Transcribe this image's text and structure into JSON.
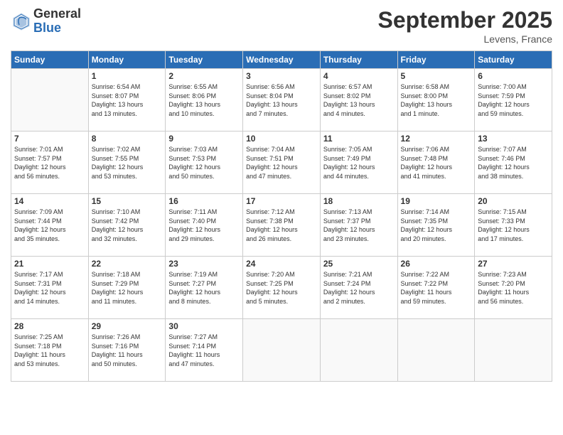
{
  "logo": {
    "general": "General",
    "blue": "Blue"
  },
  "title": "September 2025",
  "location": "Levens, France",
  "days_header": [
    "Sunday",
    "Monday",
    "Tuesday",
    "Wednesday",
    "Thursday",
    "Friday",
    "Saturday"
  ],
  "weeks": [
    [
      {
        "day": "",
        "info": ""
      },
      {
        "day": "1",
        "info": "Sunrise: 6:54 AM\nSunset: 8:07 PM\nDaylight: 13 hours\nand 13 minutes."
      },
      {
        "day": "2",
        "info": "Sunrise: 6:55 AM\nSunset: 8:06 PM\nDaylight: 13 hours\nand 10 minutes."
      },
      {
        "day": "3",
        "info": "Sunrise: 6:56 AM\nSunset: 8:04 PM\nDaylight: 13 hours\nand 7 minutes."
      },
      {
        "day": "4",
        "info": "Sunrise: 6:57 AM\nSunset: 8:02 PM\nDaylight: 13 hours\nand 4 minutes."
      },
      {
        "day": "5",
        "info": "Sunrise: 6:58 AM\nSunset: 8:00 PM\nDaylight: 13 hours\nand 1 minute."
      },
      {
        "day": "6",
        "info": "Sunrise: 7:00 AM\nSunset: 7:59 PM\nDaylight: 12 hours\nand 59 minutes."
      }
    ],
    [
      {
        "day": "7",
        "info": "Sunrise: 7:01 AM\nSunset: 7:57 PM\nDaylight: 12 hours\nand 56 minutes."
      },
      {
        "day": "8",
        "info": "Sunrise: 7:02 AM\nSunset: 7:55 PM\nDaylight: 12 hours\nand 53 minutes."
      },
      {
        "day": "9",
        "info": "Sunrise: 7:03 AM\nSunset: 7:53 PM\nDaylight: 12 hours\nand 50 minutes."
      },
      {
        "day": "10",
        "info": "Sunrise: 7:04 AM\nSunset: 7:51 PM\nDaylight: 12 hours\nand 47 minutes."
      },
      {
        "day": "11",
        "info": "Sunrise: 7:05 AM\nSunset: 7:49 PM\nDaylight: 12 hours\nand 44 minutes."
      },
      {
        "day": "12",
        "info": "Sunrise: 7:06 AM\nSunset: 7:48 PM\nDaylight: 12 hours\nand 41 minutes."
      },
      {
        "day": "13",
        "info": "Sunrise: 7:07 AM\nSunset: 7:46 PM\nDaylight: 12 hours\nand 38 minutes."
      }
    ],
    [
      {
        "day": "14",
        "info": "Sunrise: 7:09 AM\nSunset: 7:44 PM\nDaylight: 12 hours\nand 35 minutes."
      },
      {
        "day": "15",
        "info": "Sunrise: 7:10 AM\nSunset: 7:42 PM\nDaylight: 12 hours\nand 32 minutes."
      },
      {
        "day": "16",
        "info": "Sunrise: 7:11 AM\nSunset: 7:40 PM\nDaylight: 12 hours\nand 29 minutes."
      },
      {
        "day": "17",
        "info": "Sunrise: 7:12 AM\nSunset: 7:38 PM\nDaylight: 12 hours\nand 26 minutes."
      },
      {
        "day": "18",
        "info": "Sunrise: 7:13 AM\nSunset: 7:37 PM\nDaylight: 12 hours\nand 23 minutes."
      },
      {
        "day": "19",
        "info": "Sunrise: 7:14 AM\nSunset: 7:35 PM\nDaylight: 12 hours\nand 20 minutes."
      },
      {
        "day": "20",
        "info": "Sunrise: 7:15 AM\nSunset: 7:33 PM\nDaylight: 12 hours\nand 17 minutes."
      }
    ],
    [
      {
        "day": "21",
        "info": "Sunrise: 7:17 AM\nSunset: 7:31 PM\nDaylight: 12 hours\nand 14 minutes."
      },
      {
        "day": "22",
        "info": "Sunrise: 7:18 AM\nSunset: 7:29 PM\nDaylight: 12 hours\nand 11 minutes."
      },
      {
        "day": "23",
        "info": "Sunrise: 7:19 AM\nSunset: 7:27 PM\nDaylight: 12 hours\nand 8 minutes."
      },
      {
        "day": "24",
        "info": "Sunrise: 7:20 AM\nSunset: 7:25 PM\nDaylight: 12 hours\nand 5 minutes."
      },
      {
        "day": "25",
        "info": "Sunrise: 7:21 AM\nSunset: 7:24 PM\nDaylight: 12 hours\nand 2 minutes."
      },
      {
        "day": "26",
        "info": "Sunrise: 7:22 AM\nSunset: 7:22 PM\nDaylight: 11 hours\nand 59 minutes."
      },
      {
        "day": "27",
        "info": "Sunrise: 7:23 AM\nSunset: 7:20 PM\nDaylight: 11 hours\nand 56 minutes."
      }
    ],
    [
      {
        "day": "28",
        "info": "Sunrise: 7:25 AM\nSunset: 7:18 PM\nDaylight: 11 hours\nand 53 minutes."
      },
      {
        "day": "29",
        "info": "Sunrise: 7:26 AM\nSunset: 7:16 PM\nDaylight: 11 hours\nand 50 minutes."
      },
      {
        "day": "30",
        "info": "Sunrise: 7:27 AM\nSunset: 7:14 PM\nDaylight: 11 hours\nand 47 minutes."
      },
      {
        "day": "",
        "info": ""
      },
      {
        "day": "",
        "info": ""
      },
      {
        "day": "",
        "info": ""
      },
      {
        "day": "",
        "info": ""
      }
    ]
  ]
}
